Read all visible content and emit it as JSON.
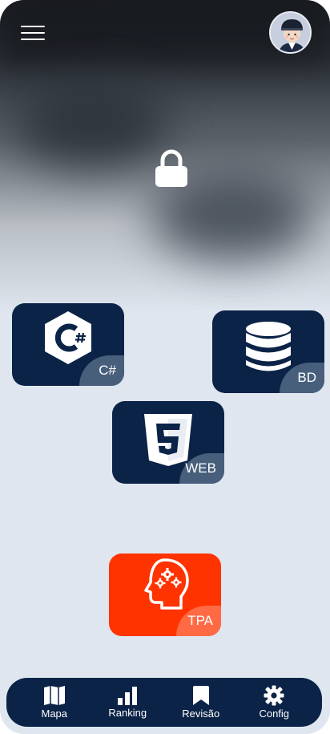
{
  "colors": {
    "background": "#dfe6ef",
    "node": "#0b2347",
    "node_tag": "#475f7b",
    "node_tpa": "#ff3300",
    "node_tpa_tag": "#ff6a45",
    "nav": "#0b2347"
  },
  "header": {
    "menu_icon": "hamburger-icon",
    "avatar_icon": "user-avatar-icon",
    "lock_icon": "lock-icon"
  },
  "nodes": [
    {
      "id": "csharp",
      "label": "C#",
      "icon": "csharp-icon",
      "locked": false
    },
    {
      "id": "bd",
      "label": "BD",
      "icon": "database-icon",
      "locked": false
    },
    {
      "id": "web",
      "label": "WEB",
      "icon": "html5-icon",
      "locked": false
    },
    {
      "id": "tpa",
      "label": "TPA",
      "icon": "brain-gears-icon",
      "locked": false
    }
  ],
  "nav": {
    "items": [
      {
        "label": "Mapa",
        "icon": "map-icon"
      },
      {
        "label": "Ranking",
        "icon": "bar-chart-icon"
      },
      {
        "label": "Revisão",
        "icon": "bookmark-icon"
      },
      {
        "label": "Config",
        "icon": "gear-icon"
      }
    ]
  }
}
